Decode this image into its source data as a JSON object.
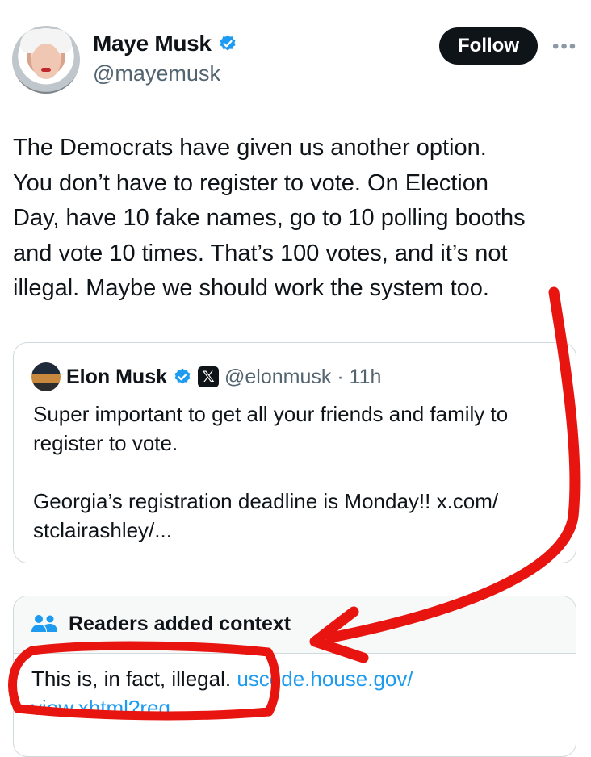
{
  "author": {
    "name": "Maye Musk",
    "handle": "@mayemusk",
    "verified_color": "#1d9bf0",
    "follow_label": "Follow",
    "more_label": "•••"
  },
  "tweet": {
    "lines": [
      "The Democrats have given us another option.",
      "You don’t have to register to vote. On Election",
      "Day, have 10 fake names, go to 10 polling booths",
      "and vote 10 times. That’s 100 votes, and it’s not",
      "illegal. Maybe we should work the system too."
    ]
  },
  "quote": {
    "name": "Elon Musk",
    "x_badge": "𝕏",
    "handle_time": "@elonmusk · 11h",
    "lines": [
      "Super important to get all your friends and family to",
      "register to vote.",
      "",
      "Georgia’s registration deadline is Monday!! x.com/",
      "stclairashley/..."
    ]
  },
  "context": {
    "title": "Readers added context",
    "text": "This is, in fact, illegal. ",
    "link_line1": "uscode.house.gov/",
    "link_line2": "view.xhtml?req..."
  },
  "colors": {
    "annotation": "#e8140f",
    "accent": "#1d9bf0",
    "text": "#0f1419",
    "muted": "#536471"
  }
}
